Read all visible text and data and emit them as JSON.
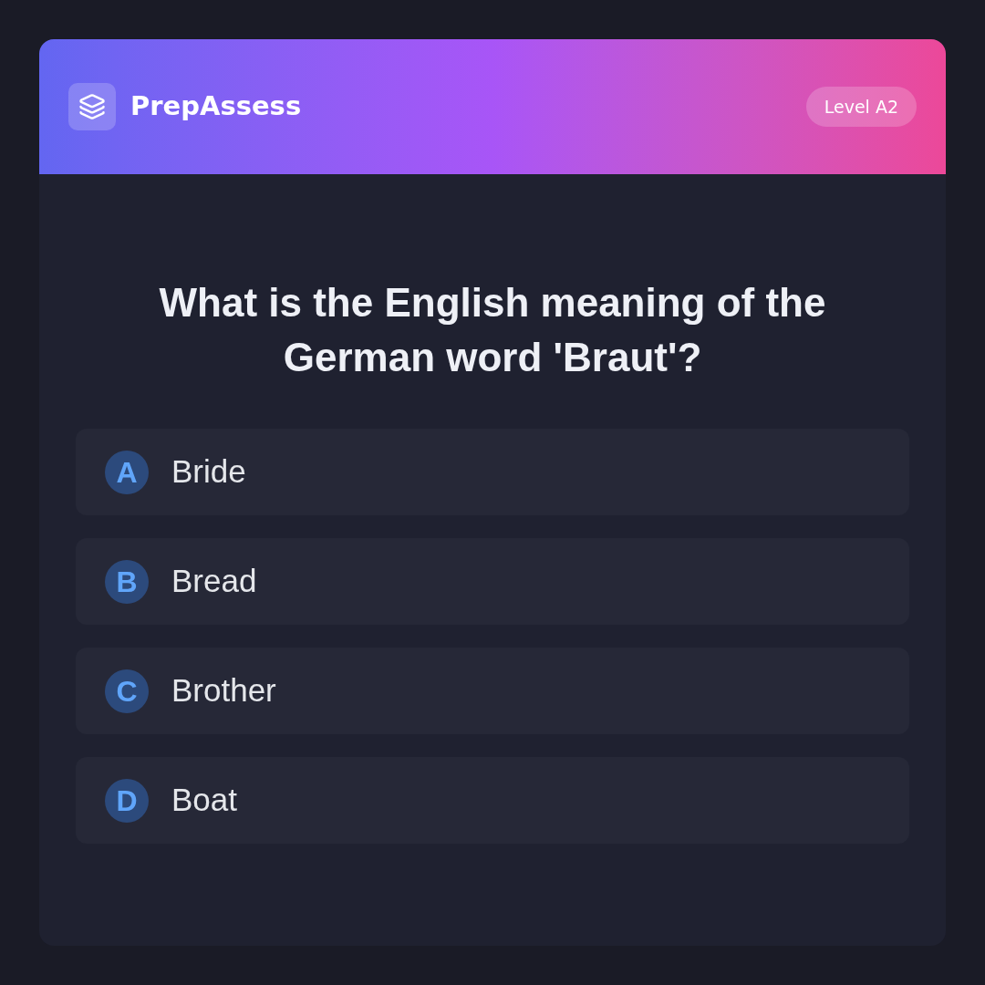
{
  "header": {
    "brand": "PrepAssess",
    "badge": "Level A2"
  },
  "question": "What is the English meaning of the German word 'Braut'?",
  "options": [
    {
      "letter": "A",
      "text": "Bride",
      "selected": false
    },
    {
      "letter": "B",
      "text": "Bread",
      "selected": false
    },
    {
      "letter": "C",
      "text": "Brother",
      "selected": false
    },
    {
      "letter": "D",
      "text": "Boat",
      "selected": false
    }
  ]
}
